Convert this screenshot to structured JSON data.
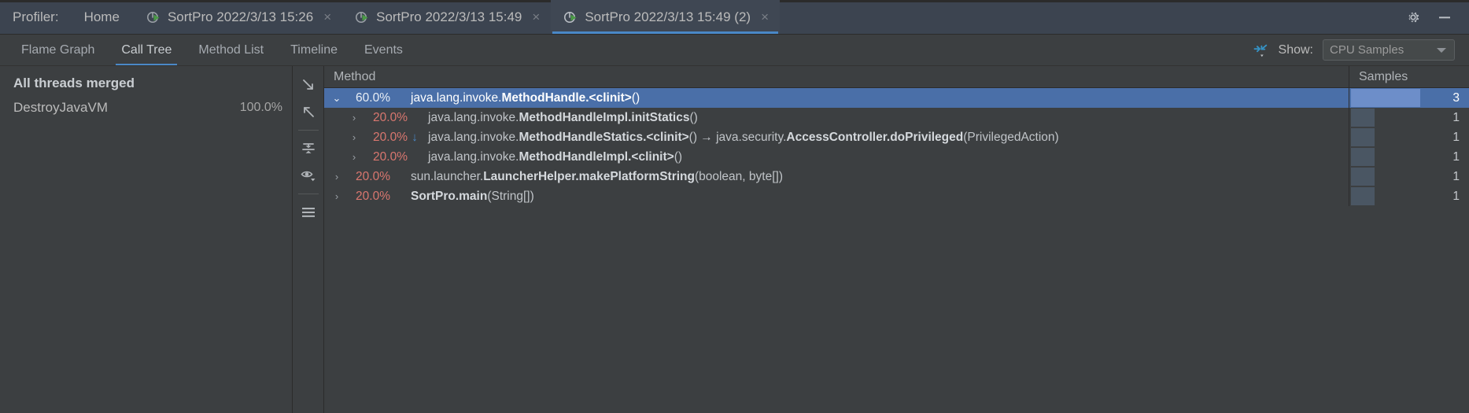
{
  "window": {
    "title_prefix": "Profiler:",
    "home_label": "Home",
    "gear_icon": "gear-icon",
    "minimize_icon": "minimize-icon"
  },
  "tabs": [
    {
      "label": "SortPro 2022/3/13 15:26",
      "active": false,
      "close": "×",
      "icon": "profiler-run-icon"
    },
    {
      "label": "SortPro 2022/3/13 15:49",
      "active": false,
      "close": "×",
      "icon": "profiler-run-icon"
    },
    {
      "label": "SortPro 2022/3/13 15:49 (2)",
      "active": true,
      "close": "×",
      "icon": "profiler-run-icon"
    }
  ],
  "view_tabs": [
    {
      "label": "Flame Graph",
      "active": false
    },
    {
      "label": "Call Tree",
      "active": true
    },
    {
      "label": "Method List",
      "active": false
    },
    {
      "label": "Timeline",
      "active": false
    },
    {
      "label": "Events",
      "active": false
    }
  ],
  "toolbar": {
    "collapse_icon": "collapse-arrows-icon",
    "show_label": "Show:",
    "show_value": "CPU Samples",
    "caret_icon": "chevron-down-icon"
  },
  "threads": {
    "header": "All threads merged",
    "items": [
      {
        "name": "DestroyJavaVM",
        "pct": "100.0%"
      }
    ]
  },
  "strip_icons": [
    {
      "name": "expand-all-icon"
    },
    {
      "name": "collapse-all-icon"
    },
    {
      "name": "separator"
    },
    {
      "name": "merge-frames-icon"
    },
    {
      "name": "filter-visibility-icon"
    },
    {
      "name": "separator"
    },
    {
      "name": "menu-icon"
    }
  ],
  "table": {
    "columns": {
      "method": "Method",
      "samples": "Samples"
    },
    "rows": [
      {
        "indent": 0,
        "chevron": "⌄",
        "expanded": true,
        "selected": true,
        "pct": "60.0%",
        "arrow": "",
        "parts": [
          {
            "t": "java.lang.invoke.",
            "b": false
          },
          {
            "t": "MethodHandle.<clinit>",
            "b": true
          },
          {
            "t": "()",
            "b": false
          }
        ],
        "samples": "3",
        "bar_pct": 58
      },
      {
        "indent": 1,
        "chevron": "›",
        "expanded": false,
        "selected": false,
        "pct": "20.0%",
        "arrow": "",
        "parts": [
          {
            "t": "java.lang.invoke.",
            "b": false
          },
          {
            "t": "MethodHandleImpl.initStatics",
            "b": true
          },
          {
            "t": "()",
            "b": false
          }
        ],
        "samples": "1",
        "bar_pct": 20
      },
      {
        "indent": 1,
        "chevron": "›",
        "expanded": false,
        "selected": false,
        "pct": "20.0%",
        "arrow": "↓",
        "parts": [
          {
            "t": "java.lang.invoke.",
            "b": false
          },
          {
            "t": "MethodHandleStatics.<clinit>",
            "b": true
          },
          {
            "t": "() → java.security.",
            "b": false
          },
          {
            "t": "AccessController.doPrivileged",
            "b": true
          },
          {
            "t": "(PrivilegedAction)",
            "b": false
          }
        ],
        "samples": "1",
        "bar_pct": 20
      },
      {
        "indent": 1,
        "chevron": "›",
        "expanded": false,
        "selected": false,
        "pct": "20.0%",
        "arrow": "",
        "parts": [
          {
            "t": "java.lang.invoke.",
            "b": false
          },
          {
            "t": "MethodHandleImpl.<clinit>",
            "b": true
          },
          {
            "t": "()",
            "b": false
          }
        ],
        "samples": "1",
        "bar_pct": 20
      },
      {
        "indent": 0,
        "chevron": "›",
        "expanded": false,
        "selected": false,
        "pct": "20.0%",
        "arrow": "",
        "parts": [
          {
            "t": "sun.launcher.",
            "b": false
          },
          {
            "t": "LauncherHelper.makePlatformString",
            "b": true
          },
          {
            "t": "(boolean, byte[])",
            "b": false
          }
        ],
        "samples": "1",
        "bar_pct": 20
      },
      {
        "indent": 0,
        "chevron": "›",
        "expanded": false,
        "selected": false,
        "pct": "20.0%",
        "arrow": "",
        "parts": [
          {
            "t": "SortPro.main",
            "b": true
          },
          {
            "t": "(String[])",
            "b": false
          }
        ],
        "samples": "1",
        "bar_pct": 20
      }
    ]
  },
  "colors": {
    "accent_blue": "#4a88c7",
    "selection_blue": "#4a6fa8",
    "percent_red": "#d9776f",
    "background": "#3c3f41",
    "tabbar_bg": "#3c4450"
  }
}
